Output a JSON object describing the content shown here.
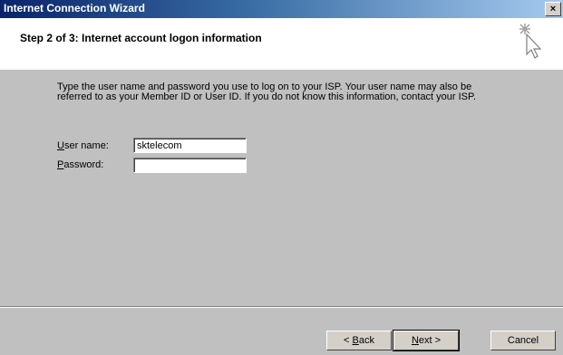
{
  "window": {
    "title": "Internet Connection Wizard",
    "close_glyph": "×"
  },
  "header": {
    "title": "Step 2 of 3: Internet account logon information",
    "icon": "wizard-icon"
  },
  "description": "Type the user name and password you use to log on to your ISP. Your user name may also be referred to as your Member ID or User ID. If you do not know this information, contact your ISP.",
  "form": {
    "username_label_mn": "U",
    "username_label_rest": "ser name:",
    "username_value": "sktelecom",
    "password_label_mn": "P",
    "password_label_rest": "assword:",
    "password_value": ""
  },
  "buttons": {
    "back_prefix": "< ",
    "back_mn": "B",
    "back_rest": "ack",
    "next_mn": "N",
    "next_rest": "ext >",
    "cancel": "Cancel"
  }
}
